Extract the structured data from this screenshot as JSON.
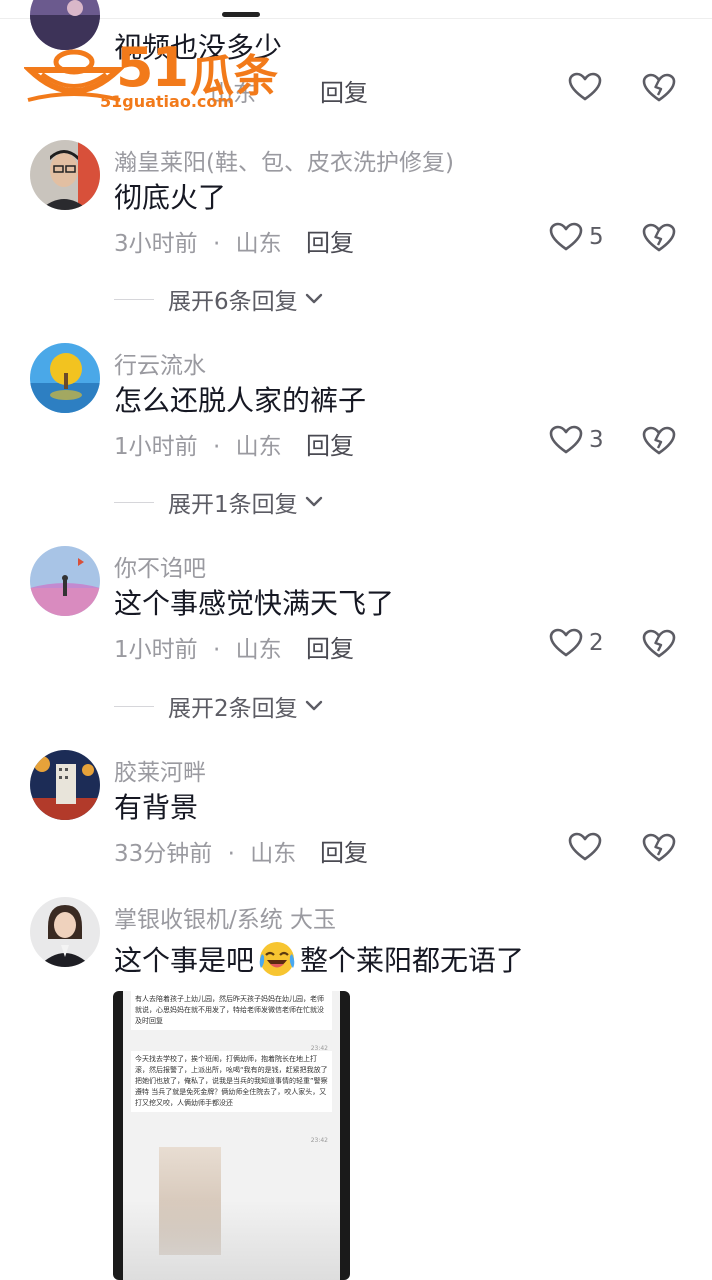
{
  "watermark": {
    "brand_num": "51",
    "brand_cn": "瓜条",
    "url": "51guatiao.com"
  },
  "comments": [
    {
      "username": "",
      "text": "视频也没多少",
      "time": "",
      "location": "山东",
      "reply_label": "回复",
      "likes": ""
    },
    {
      "username": "瀚皇莱阳(鞋、包、皮衣洗护修复)",
      "text": "彻底火了",
      "time": "3小时前",
      "location": "山东",
      "reply_label": "回复",
      "likes": "5",
      "expand_label": "展开6条回复"
    },
    {
      "username": "行云流水",
      "text": "怎么还脱人家的裤子",
      "time": "1小时前",
      "location": "山东",
      "reply_label": "回复",
      "likes": "3",
      "expand_label": "展开1条回复"
    },
    {
      "username": "你不诌吧",
      "text": "这个事感觉快满天飞了",
      "time": "1小时前",
      "location": "山东",
      "reply_label": "回复",
      "likes": "2",
      "expand_label": "展开2条回复"
    },
    {
      "username": "胶莱河畔",
      "text": "有背景",
      "time": "33分钟前",
      "location": "山东",
      "reply_label": "回复",
      "likes": ""
    },
    {
      "username": "掌银收银机/系统 大玉",
      "text_before": "这个事是吧",
      "text_after": "整个莱阳都无语了",
      "emoji": "laughing-crying-emoji"
    }
  ],
  "separator": "·",
  "attached_image": {
    "bubble1": "有人去陪着孩子上幼儿园，然后昨天孩子妈妈在幼儿园，老师就说，心思妈妈在就不用发了，特给老师发微信老师在忙就没及时回复",
    "time1": "23:42",
    "bubble2": "今天找去学校了，挨个班闹，打俩幼师，抱着院长在地上打滚，然后报警了，上派出所，吆喝“我有的是钱，赶紧把我放了把她们也放了，俺私了，说我是当兵的我知道事情的轻重”警察遵特 当兵了就是免死金牌？俩幼师全住院去了，咬人家头，又打又挖又咬，人俩幼师手都没还",
    "time2": "23:42"
  },
  "colors": {
    "accent": "#f27a1a",
    "meta_gray": "#9a9aa0",
    "text": "#161823"
  }
}
